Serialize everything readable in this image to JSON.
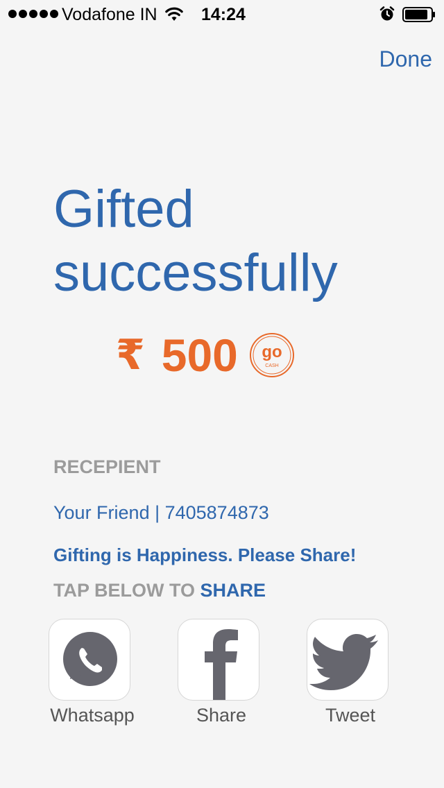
{
  "status_bar": {
    "carrier": "Vodafone IN",
    "time": "14:24",
    "signal_icon": "signal-dots-icon",
    "wifi_icon": "wifi-icon",
    "alarm_icon": "alarm-icon",
    "battery_icon": "battery-icon",
    "battery_level": 0.9
  },
  "header": {
    "done_label": "Done"
  },
  "main": {
    "title_line1": "Gifted",
    "title_line2": "successfully",
    "currency_symbol": "₹",
    "amount": "500",
    "brand_logo_icon": "go-cash-logo",
    "brand_logo_text_top": "go",
    "brand_logo_text_bottom": "CASH"
  },
  "recipient": {
    "label": "RECEPIENT",
    "value": "Your Friend | 7405874873"
  },
  "share": {
    "message": "Gifting is Happiness. Please Share!",
    "prompt_prefix": "TAP BELOW TO ",
    "prompt_emphasis": "SHARE",
    "options": [
      {
        "label": "Whatsapp",
        "icon": "whatsapp-icon"
      },
      {
        "label": "Share",
        "icon": "facebook-icon"
      },
      {
        "label": "Tweet",
        "icon": "twitter-icon"
      }
    ]
  },
  "colors": {
    "primary_blue": "#2f67ad",
    "accent_orange": "#e8692a",
    "muted_gray": "#9b9b9b",
    "icon_gray": "#66666e",
    "background": "#f5f5f5"
  }
}
